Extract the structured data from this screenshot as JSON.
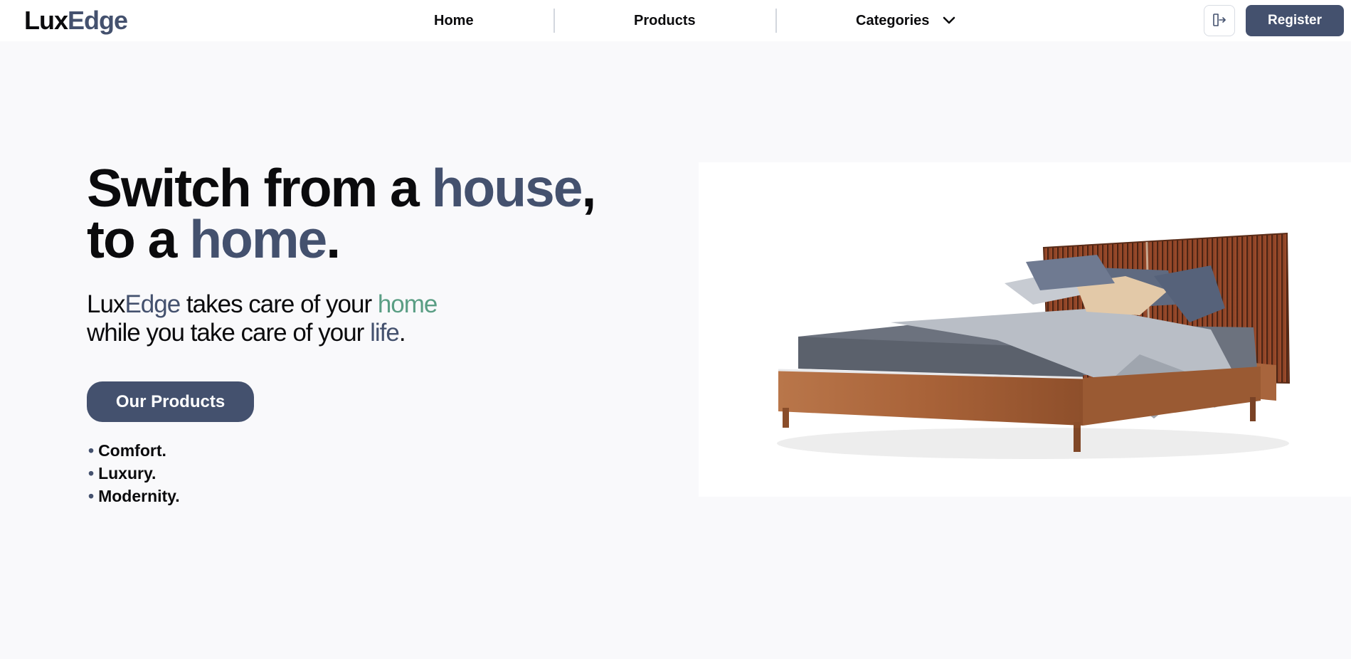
{
  "brand": {
    "name_part1": "Lux",
    "name_part2": "Edge",
    "accent_color": "#44516e",
    "secondary_color": "#5a9e84"
  },
  "nav": {
    "home": "Home",
    "products": "Products",
    "categories": "Categories",
    "categories_icon": "chevron-down-icon",
    "login_icon": "sign-in-icon",
    "register": "Register"
  },
  "hero": {
    "headline": {
      "line1_prefix": "Switch from a ",
      "line1_accent": "house",
      "line1_suffix": ",",
      "line2_prefix": "to a ",
      "line2_accent": "home",
      "line2_suffix": "."
    },
    "tagline": {
      "brand_part1": "Lux",
      "brand_part2": "Edge",
      "line1_mid": " takes care of your ",
      "line1_accent": "home",
      "line2_prefix": "while you take care of your ",
      "line2_accent": "life",
      "line2_suffix": "."
    },
    "cta": "Our Products",
    "features": [
      "Comfort.",
      "Luxury.",
      "Modernity."
    ],
    "image_subject": "bed-image"
  }
}
